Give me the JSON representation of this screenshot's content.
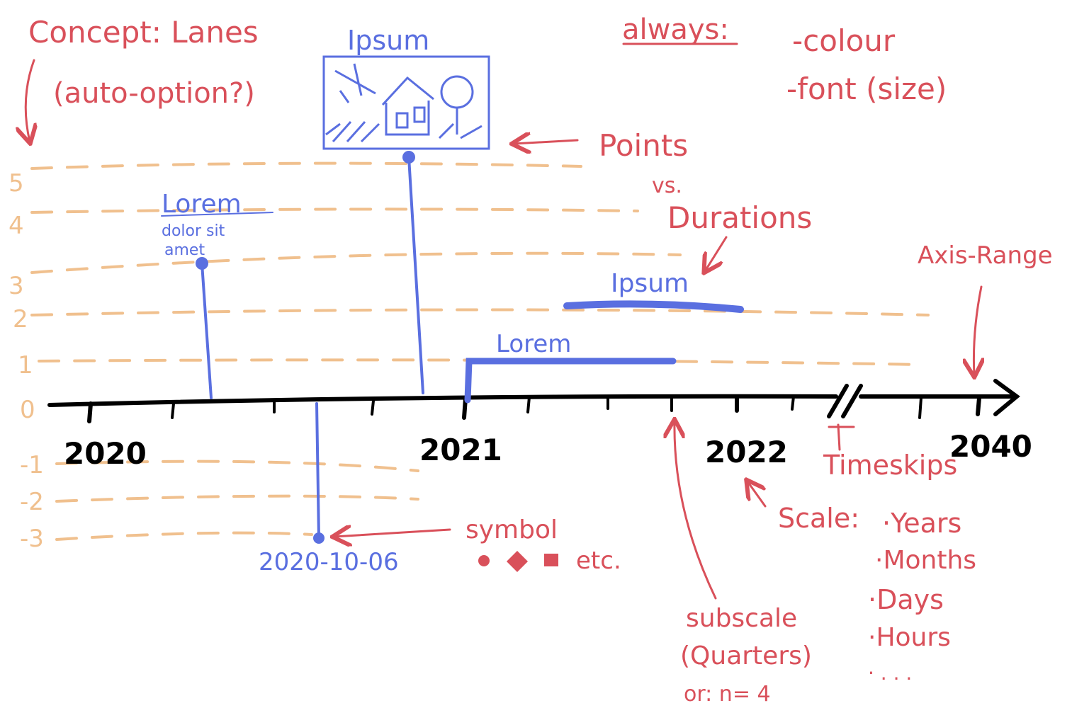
{
  "colors": {
    "annotation": "#d9505a",
    "items": "#5a6fe0",
    "lanes": "#f0c08e",
    "axis": "#000000"
  },
  "concept": {
    "title": "Concept: Lanes",
    "subtitle": "(auto-option?)"
  },
  "always": {
    "label": "always:",
    "items": [
      "-colour",
      "-font (size)"
    ]
  },
  "lanes": [
    "5",
    "4",
    "3",
    "2",
    "1",
    "0",
    "-1",
    "-2",
    "-3"
  ],
  "axis": {
    "year_labels": [
      "2020",
      "2021",
      "2022",
      "2040"
    ]
  },
  "events": {
    "image_point": {
      "label": "Ipsum",
      "icon": "house-landscape-picture-icon"
    },
    "text_point": {
      "title": "Lorem",
      "subtitle": "dolor sit",
      "body": "amet"
    },
    "below_point": {
      "label": "2020-10-06"
    },
    "duration_upper": {
      "label": "Ipsum"
    },
    "duration_lower": {
      "label": "Lorem"
    }
  },
  "notes": {
    "points": "Points",
    "vs": "vs.",
    "durations": "Durations",
    "axis_range": "Axis-Range",
    "symbol": "symbol",
    "symbol_examples": "etc.",
    "timeskips": "Timeskips",
    "scale_label": "Scale:",
    "scale_options": [
      "·Years",
      "·Months",
      "·Days",
      "·Hours",
      "· . . ."
    ],
    "subscale": "subscale",
    "subscale_detail": "(Quarters)",
    "subscale_alt": "or: n= 4"
  }
}
